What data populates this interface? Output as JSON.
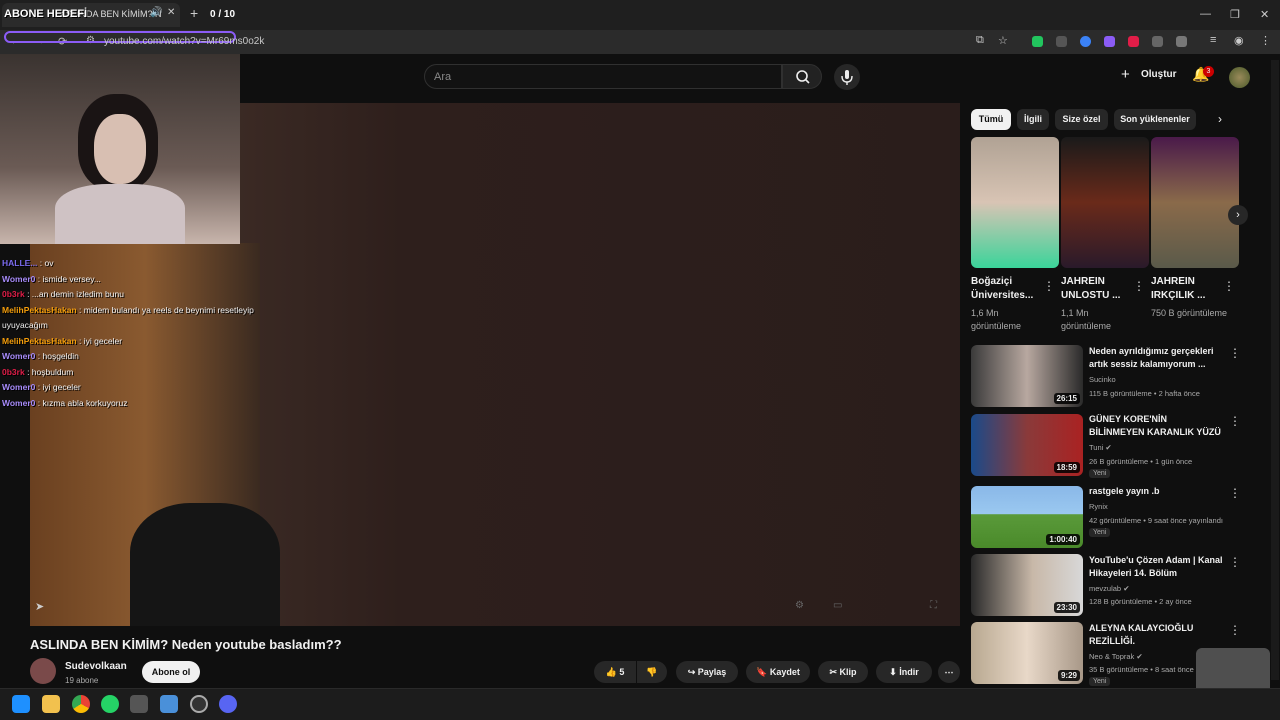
{
  "browser": {
    "tab_title": "ASLINDA BEN KİMİM? N",
    "url": "youtube.com/watch?v=Mr69ms0o2k"
  },
  "overlay": {
    "goal_label": "ABONE HEDEFİ",
    "goal_count": "0 / 10"
  },
  "search": {
    "placeholder": "Ara"
  },
  "header": {
    "create_label": "Oluştur",
    "notif_count": "3"
  },
  "chat": [
    {
      "user": "HALLE...",
      "msg": ": ov",
      "color": "#7c6cf0"
    },
    {
      "user": "Womer0",
      "msg": ": ismide versey...",
      "color": "#a78bfa"
    },
    {
      "user": "0b3rk",
      "msg": ": ...an demin izledim bunu",
      "color": "#e11d48"
    },
    {
      "user": "MelihPektasHakan",
      "msg": ": midem bulandı ya reels de beynimi resetleyip",
      "color": "#f59e0b"
    },
    {
      "user": "",
      "msg": "uyuyacağım",
      "color": "#fff"
    },
    {
      "user": "MelihPektasHakan",
      "msg": ": iyi geceler",
      "color": "#f59e0b"
    },
    {
      "user": "Womer0",
      "msg": ": hoşgeldin",
      "color": "#a78bfa"
    },
    {
      "user": "0b3rk",
      "msg": ": hoşbuldum",
      "color": "#e11d48"
    },
    {
      "user": "Womer0",
      "msg": ": iyi geceler",
      "color": "#a78bfa"
    },
    {
      "user": "Womer0",
      "msg": ": kızma abla korkuyoruz",
      "color": "#a78bfa"
    }
  ],
  "video": {
    "title": "ASLINDA BEN KİMİM? Neden youtube basladım??",
    "channel": "Sudevolkaan",
    "subs": "19 abone",
    "subscribe_label": "Abone ol",
    "likes": "5",
    "share_label": "Paylaş",
    "save_label": "Kaydet",
    "clip_label": "Klip",
    "download_label": "İndir"
  },
  "chips": [
    "Tümü",
    "İlgili",
    "Size özel",
    "Son yüklenenler"
  ],
  "shorts": [
    {
      "title": "Boğaziçi Üniversites...",
      "views": "1,6 Mn görüntüleme"
    },
    {
      "title": "JAHREIN UNLOSTU ...",
      "views": "1,1 Mn görüntüleme"
    },
    {
      "title": "JAHREIN IRKÇILIK ...",
      "views": "750 B görüntüleme"
    }
  ],
  "recommendations": [
    {
      "title": "Neden ayrıldığımız gerçekleri artık sessiz kalamıyorum ...",
      "channel": "Sucinko",
      "meta": "115 B görüntüleme • 2 hafta önce",
      "duration": "26:15",
      "new": ""
    },
    {
      "title": "GÜNEY KORE'NİN BİLİNMEYEN KARANLIK YÜZÜ",
      "channel": "Tuni",
      "meta": "26 B görüntüleme • 1 gün önce",
      "duration": "18:59",
      "new": "Yeni"
    },
    {
      "title": "rastgele yayın .b",
      "channel": "Rynix",
      "meta": "42 görüntüleme • 9 saat önce yayınlandı",
      "duration": "1:00:40",
      "new": "Yeni"
    },
    {
      "title": "YouTube'u Çözen Adam | Kanal Hikayeleri 14. Bölüm",
      "channel": "mevzulab",
      "meta": "128 B görüntüleme • 2 ay önce",
      "duration": "23:30",
      "new": ""
    },
    {
      "title": "ALEYNA KALAYCIOĞLU REZİLLİĞİ.",
      "channel": "Neo & Toprak",
      "meta": "35 B görüntüleme • 8 saat önce",
      "duration": "9:29",
      "new": "Yeni"
    }
  ],
  "colors": {
    "accent": "#8b5cf6",
    "bg": "#0f0f0f",
    "notif": "#cc0000"
  }
}
